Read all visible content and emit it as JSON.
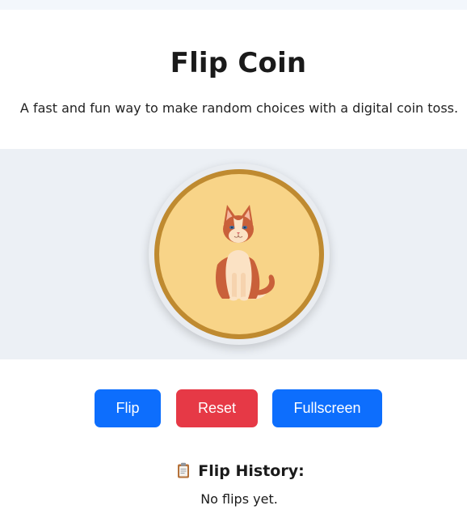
{
  "header": {
    "title": "Flip Coin",
    "subtitle": "A fast and fun way to make random choices with a digital coin toss."
  },
  "coin": {
    "face_icon": "cat-icon",
    "fill_color": "#f8d488",
    "rim_color": "#bf8a30"
  },
  "controls": {
    "flip_label": "Flip",
    "reset_label": "Reset",
    "fullscreen_label": "Fullscreen",
    "primary_color": "#0d6efd",
    "danger_color": "#e63946"
  },
  "history": {
    "icon": "clipboard-icon",
    "title": "Flip History:",
    "empty_text": "No flips yet."
  }
}
